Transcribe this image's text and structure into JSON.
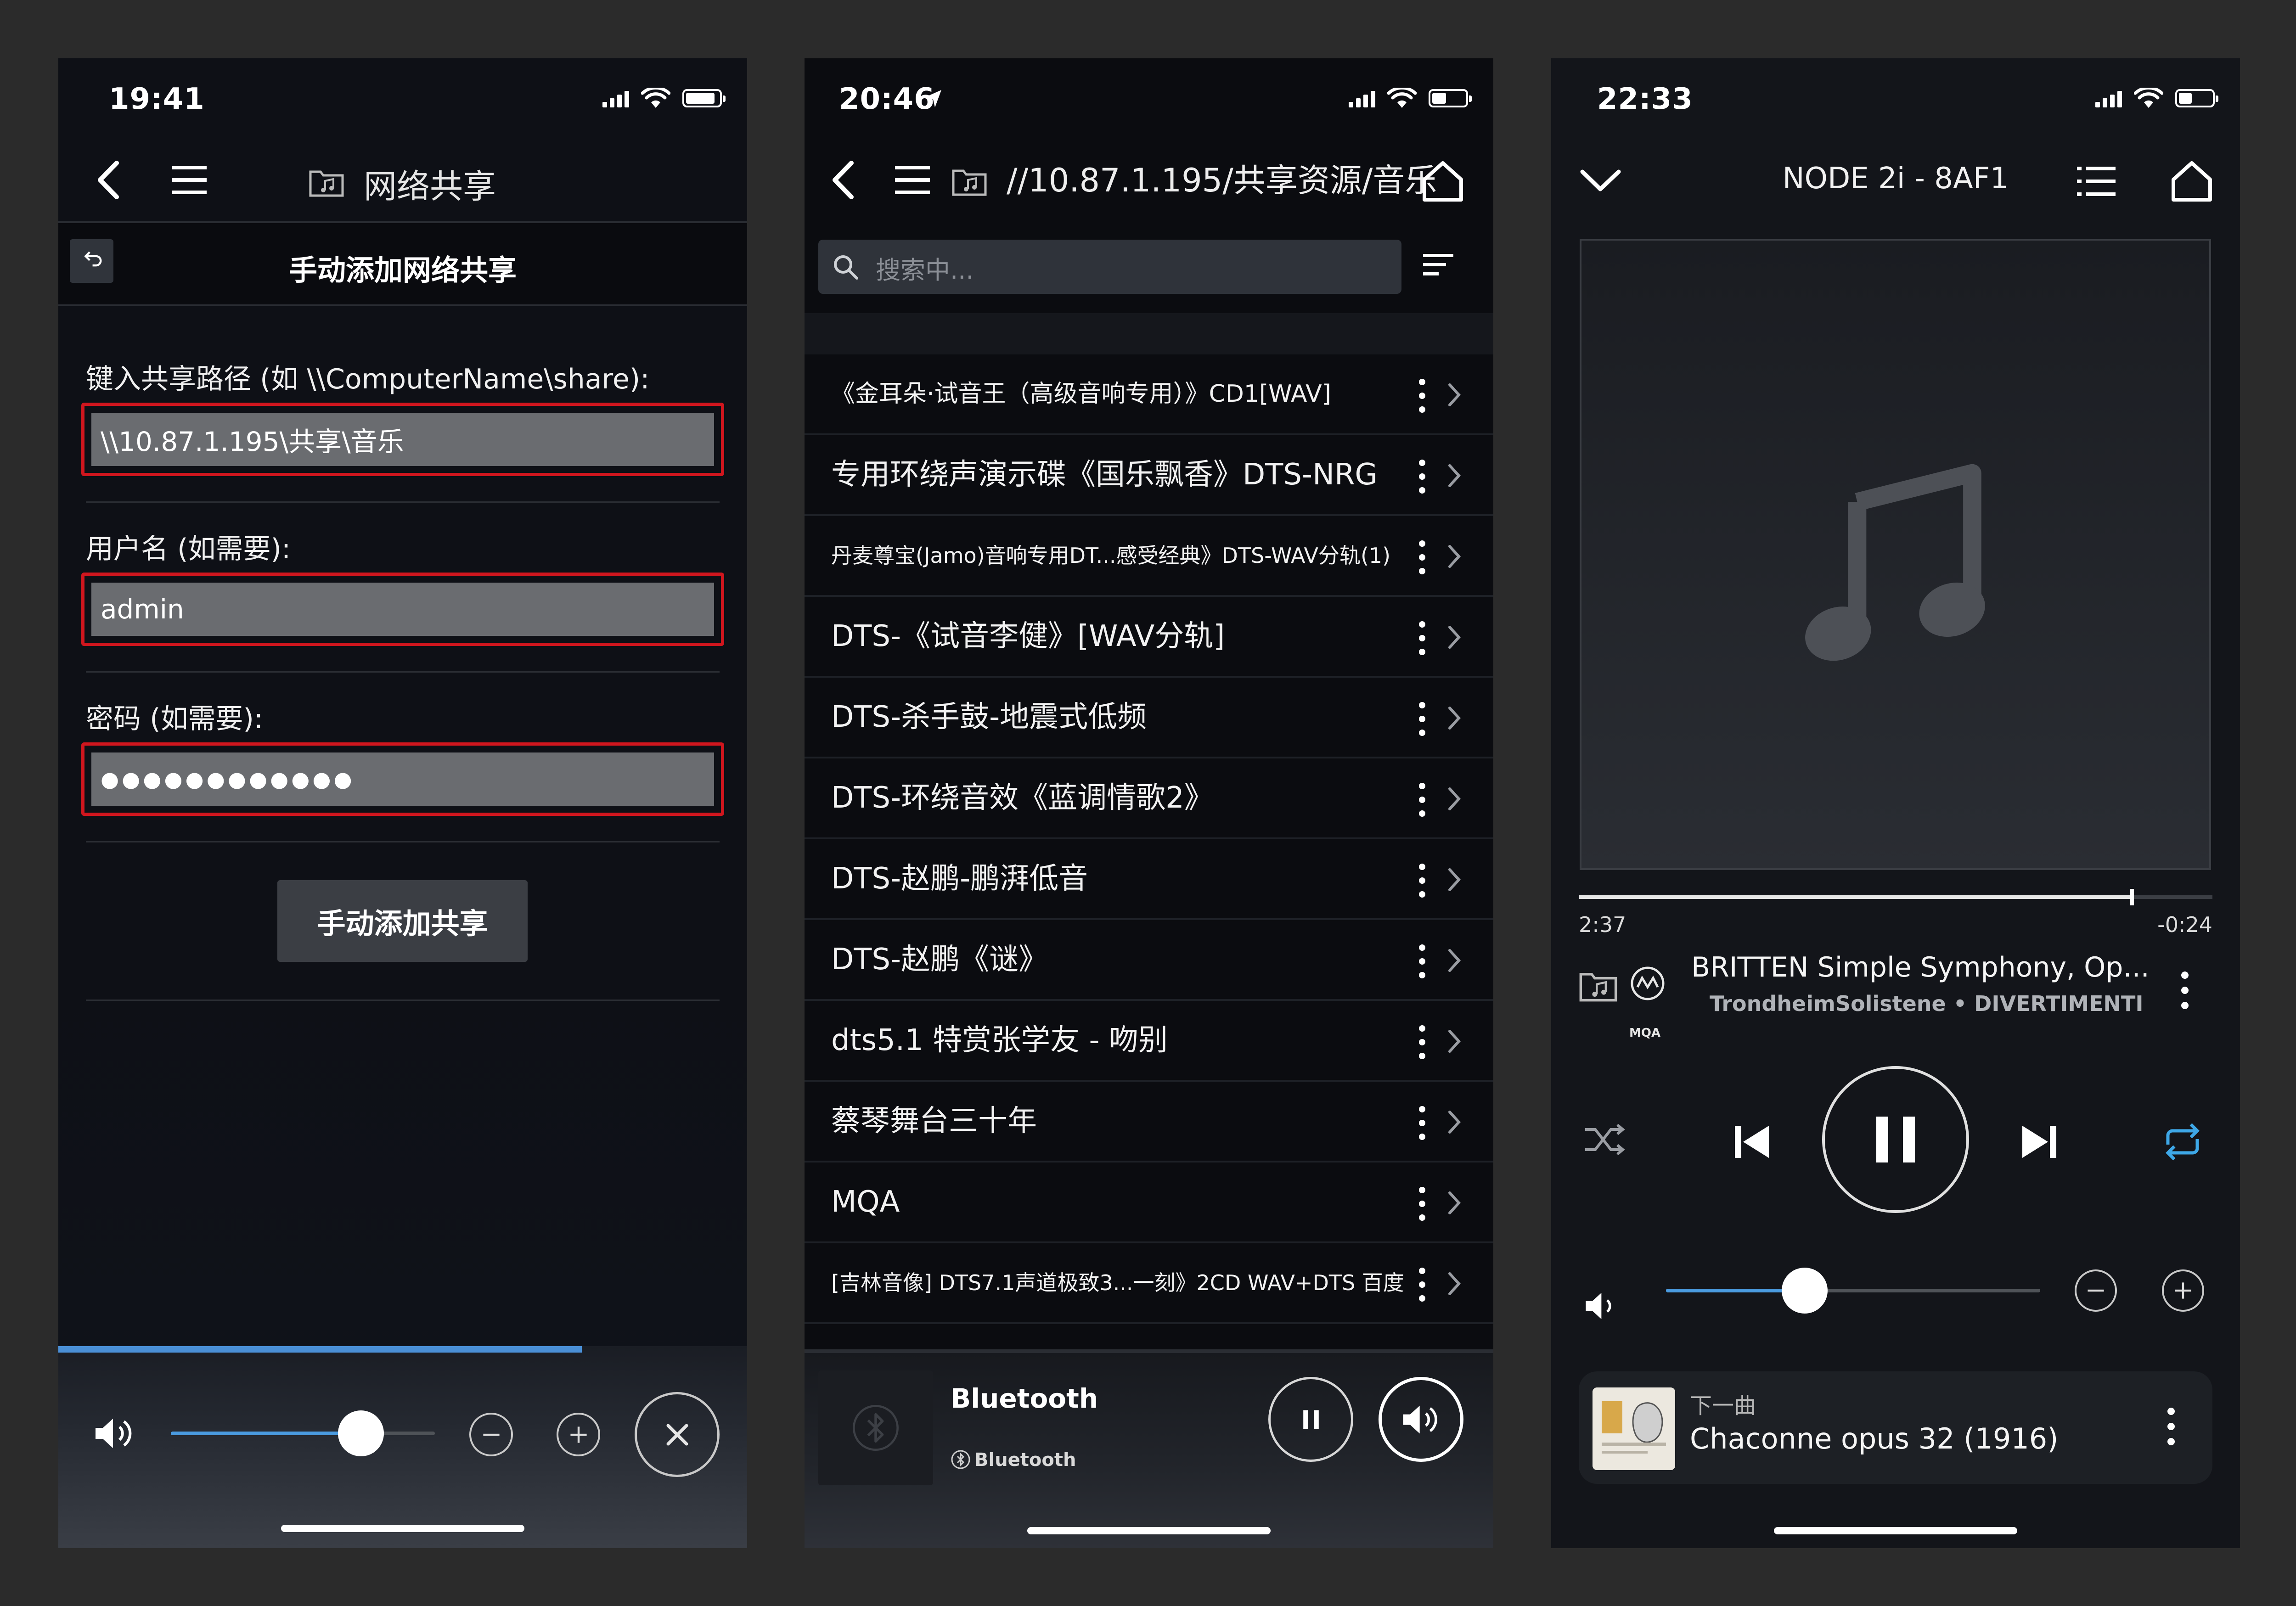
{
  "phone1": {
    "time": "19:41",
    "nav_title": "网络共享",
    "subheader_title": "手动添加网络共享",
    "path_label": "键入共享路径 (如 \\\\ComputerName\\share):",
    "path_value": "\\\\10.87.1.195\\共享\\音乐",
    "user_label": "用户名 (如需要):",
    "user_value": "admin",
    "password_label": "密码 (如需要):",
    "password_value": "●●●●●●●●●●●●",
    "add_button": "手动添加共享",
    "volume": 0.72,
    "progress": 0.76,
    "accent": "#4a9be0",
    "highlight": "#d0161e"
  },
  "phone2": {
    "time": "20:46",
    "path_title": "//10.87.1.195/共享资源/音乐",
    "search_placeholder": "搜索中...",
    "items": [
      {
        "label": "《金耳朵·试音王（高级音响专用）》CD1[WAV]",
        "size": "med"
      },
      {
        "label": "专用环绕声演示碟《国乐飘香》DTS-NRG",
        "size": ""
      },
      {
        "label": "丹麦尊宝(Jamo)音响专用DT...感受经典》DTS-WAV分轨(1)",
        "size": "small"
      },
      {
        "label": "DTS-《试音李健》[WAV分轨]",
        "size": ""
      },
      {
        "label": "DTS-杀手鼓-地震式低频",
        "size": ""
      },
      {
        "label": "DTS-环绕音效《蓝调情歌2》",
        "size": ""
      },
      {
        "label": "DTS-赵鹏-鹏湃低音",
        "size": ""
      },
      {
        "label": "DTS-赵鹏《谜》",
        "size": ""
      },
      {
        "label": "dts5.1 特赏张学友 - 吻别",
        "size": ""
      },
      {
        "label": "蔡琴舞台三十年",
        "size": ""
      },
      {
        "label": "MQA",
        "size": ""
      },
      {
        "label": "[吉林音像] DTS7.1声道极致3...一刻》2CD WAV+DTS 百度",
        "size": "small"
      }
    ],
    "miniplayer_title": "Bluetooth",
    "miniplayer_sub": "Bluetooth"
  },
  "phone3": {
    "time": "22:33",
    "device_title": "NODE 2i - 8AF1",
    "elapsed": "2:37",
    "remaining": "-0:24",
    "progress": 0.87,
    "track_title": "BRITTEN Simple Symphony, Op...",
    "track_sub": "TrondheimSolistene • DIVERTIMENTI",
    "mqa_badge": "MQA",
    "volume": 0.37,
    "next_label": "下一曲",
    "next_track": "Chaconne opus 32 (1916)",
    "repeat_color": "#3ea8e8"
  }
}
